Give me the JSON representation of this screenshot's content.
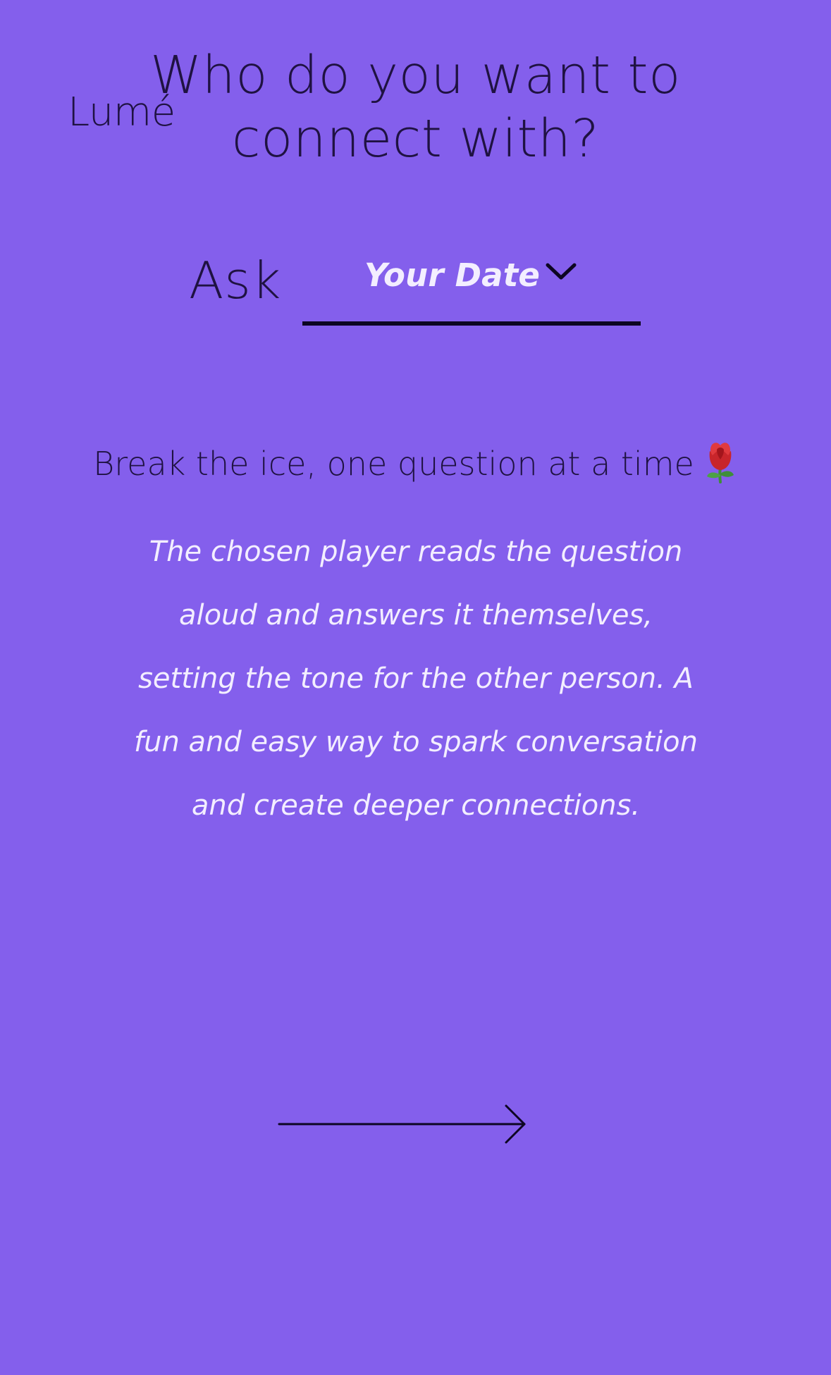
{
  "app": {
    "logo_text": "Lumé"
  },
  "header": {
    "title": "Who do you want to connect with?"
  },
  "recipient_selector": {
    "prefix_label": "Ask",
    "selected_value": "Your Date",
    "dropdown_icon": "chevron-down-icon"
  },
  "intro": {
    "tagline": "Break the ice, one question at a time",
    "tagline_icon": "rose-icon",
    "description": "The chosen player reads the question aloud and answers it themselves, setting the tone for the other person. A fun and easy way to spark conversation and create deeper connections."
  },
  "navigation": {
    "next_icon": "arrow-right-icon"
  },
  "colors": {
    "background": "#845FEC",
    "dark_text": "#1F1242",
    "light_text": "#F3EEFF",
    "underline": "#0D0622"
  }
}
